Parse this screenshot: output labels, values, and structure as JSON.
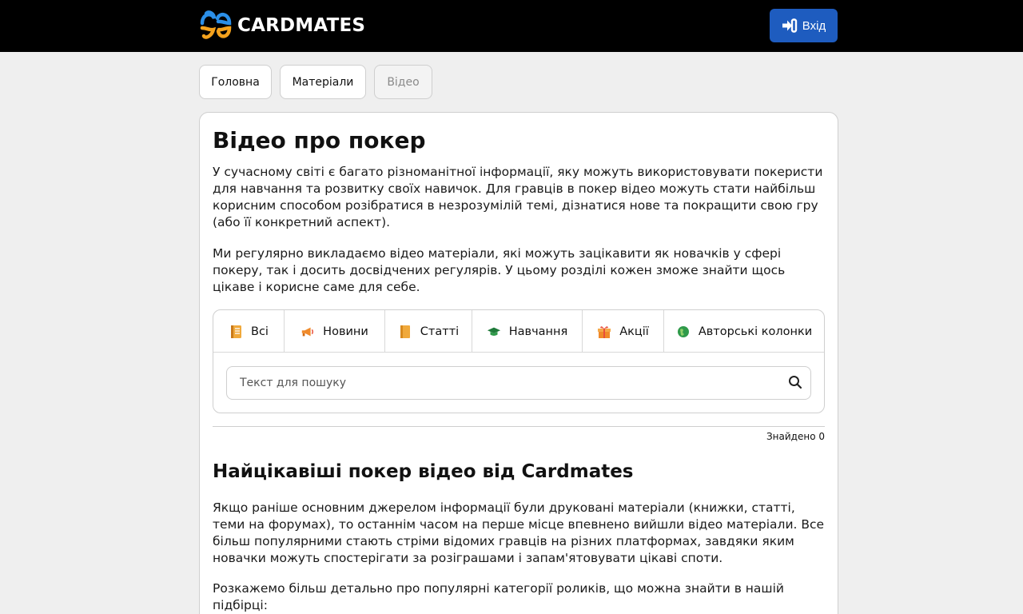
{
  "header": {
    "brand": "CARDMATES",
    "login_label": "Вхід",
    "colors": {
      "bar": "#000000",
      "login_bg": "#1e5cbf",
      "logo_blue": "#2b8fe8",
      "logo_orange": "#f4a21d"
    }
  },
  "breadcrumb": [
    {
      "label": "Головна"
    },
    {
      "label": "Матеріали"
    },
    {
      "label": "Відео"
    }
  ],
  "page": {
    "title": "Відео про покер",
    "intro_1": "У сучасному світі є багато різноманітної інформації, яку можуть використовувати покеристи для навчання та розвитку своїх навичок. Для гравців в покер відео можуть стати найбільш корисним способом розібратися в незрозумілій темі, дізнатися нове та покращити свою гру (або її конкретний аспект).",
    "intro_2": "Ми регулярно викладаємо відео матеріали, які можуть зацікавити як новачків у сфері покеру, так і досить досвідчених регулярів. У цьому розділі кожен зможе знайти щось цікаве і корисне саме для себе."
  },
  "filters": {
    "tabs": [
      {
        "label": "Всі",
        "icon": "notebook-icon"
      },
      {
        "label": "Новини",
        "icon": "megaphone-icon"
      },
      {
        "label": "Статті",
        "icon": "book-icon"
      },
      {
        "label": "Навчання",
        "icon": "graduation-cap-icon"
      },
      {
        "label": "Акції",
        "icon": "gift-icon"
      },
      {
        "label": "Авторські колонки",
        "icon": "globe-icon"
      }
    ],
    "search_placeholder": "Текст для пошуку",
    "found": "Знайдено 0"
  },
  "section": {
    "title": "Найцікавіші покер відео від Cardmates",
    "para_1": "Якщо раніше основним джерелом інформації були друковані матеріали (книжки, статті, теми на форумах), то останнім часом на перше місце впевнено вийшли відео матеріали. Все більш популярними стають стріми відомих гравців на різних платформах, завдяки яким новачки можуть спостерігати за розіграшами і запам'ятовувати цікаві споти.",
    "para_2": "Розкажемо більш детально про популярні категорії роликів, що можна знайти в нашій підбірці:"
  }
}
